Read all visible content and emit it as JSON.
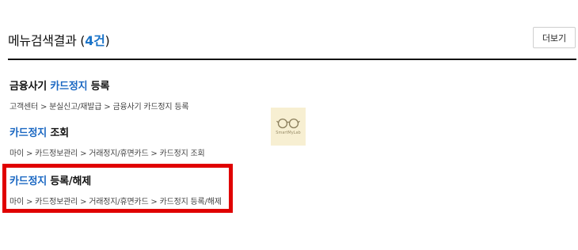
{
  "header": {
    "title_prefix": "메뉴검색결과 (",
    "count": "4건",
    "title_suffix": ")",
    "more_label": "더보기"
  },
  "results": [
    {
      "title_before": "금융사기 ",
      "title_highlight": "카드정지",
      "title_after": " 등록",
      "path": "고객센터 > 분실신고/재발급 > 금융사기 카드정지 등록"
    },
    {
      "title_before": "",
      "title_highlight": "카드정지",
      "title_after": " 조회",
      "path": "마이 > 카드정보관리 > 거래정지/휴면카드 > 카드정지 조회"
    },
    {
      "title_before": "",
      "title_highlight": "카드정지",
      "title_after": " 등록/해제",
      "path": "마이 > 카드정보관리 > 거래정지/휴면카드 > 카드정지 등록/해제"
    }
  ],
  "watermark": {
    "text": "SmartMyLab",
    "icon": "glasses-icon"
  },
  "colors": {
    "accent": "#1a67c2",
    "highlight_box": "#e00000"
  }
}
